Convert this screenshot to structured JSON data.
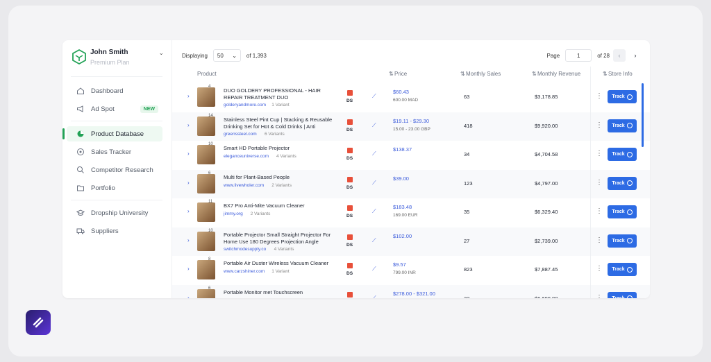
{
  "user": {
    "name": "John Smith",
    "plan": "Premium Plan"
  },
  "nav": {
    "dashboard": "Dashboard",
    "ad_spot": "Ad Spot",
    "new_badge": "NEW",
    "product_database": "Product Database",
    "sales_tracker": "Sales Tracker",
    "competitor_research": "Competitor Research",
    "portfolio": "Portfolio",
    "dropship_university": "Dropship University",
    "suppliers": "Suppliers"
  },
  "toolbar": {
    "displaying_label": "Displaying",
    "per_page": "50",
    "of_total": "of 1,393",
    "page_label": "Page",
    "page_value": "1",
    "of_pages": "of 28"
  },
  "table": {
    "headers": {
      "product": "Product",
      "price": "Price",
      "monthly_sales": "Monthly Sales",
      "monthly_revenue": "Monthly Revenue",
      "store_info": "Store Info"
    },
    "track_label": "Track",
    "ds_label": "DS",
    "rows": [
      {
        "name": "DUO GOLDERY PROFESSIONAL - HAIR REPAIR TREATMENT DUO",
        "domain": "golderyandmore.com",
        "variants": "1 Variant",
        "images": "4",
        "price": "$60.43",
        "price_local": "600.00 MAD",
        "sales": "63",
        "revenue": "$3,178.85"
      },
      {
        "name": "Stainless Steel Pint Cup | Stacking & Reusable Drinking Set for Hot & Cold Drinks | Anti",
        "domain": "greenssteel.com",
        "variants": "6 Variants",
        "images": "14",
        "price": "$19.11 - $29.30",
        "price_local": "15.00 - 23.00 GBP",
        "sales": "418",
        "revenue": "$9,920.00"
      },
      {
        "name": "Smart HD Portable Projector",
        "domain": "eleganceuniverse.com",
        "variants": "4 Variants",
        "images": "10",
        "price": "$138.37",
        "price_local": "",
        "sales": "34",
        "revenue": "$4,704.58"
      },
      {
        "name": "Multi for Plant-Based People",
        "domain": "www.livewholer.com",
        "variants": "2 Variants",
        "images": "6",
        "price": "$39.00",
        "price_local": "",
        "sales": "123",
        "revenue": "$4,797.00"
      },
      {
        "name": "BX7 Pro Anti-Mite Vacuum Cleaner",
        "domain": "jimmy.org",
        "variants": "2 Variants",
        "images": "11",
        "price": "$183.48",
        "price_local": "169.00 EUR",
        "sales": "35",
        "revenue": "$6,329.40"
      },
      {
        "name": "Portable Projector Small Straight Projector For Home Use 180 Degrees Projection Angle",
        "domain": "switchmodesupply.co",
        "variants": "4 Variants",
        "images": "10",
        "price": "$102.00",
        "price_local": "",
        "sales": "27",
        "revenue": "$2,739.00"
      },
      {
        "name": "Portable Air Duster Wireless Vacuum Cleaner",
        "domain": "www.carzshiner.com",
        "variants": "1 Variant",
        "images": "8",
        "price": "$9.57",
        "price_local": "799.00 INR",
        "sales": "823",
        "revenue": "$7,887.45"
      },
      {
        "name": "Portable Monitor met Touchscreen",
        "domain": "",
        "variants": "",
        "images": "6",
        "price": "$278.00 - $321.00",
        "price_local": "",
        "sales": "32",
        "revenue": "$6,699.00"
      }
    ]
  },
  "colors": {
    "accent": "#2d6be4",
    "green": "#22a256"
  }
}
